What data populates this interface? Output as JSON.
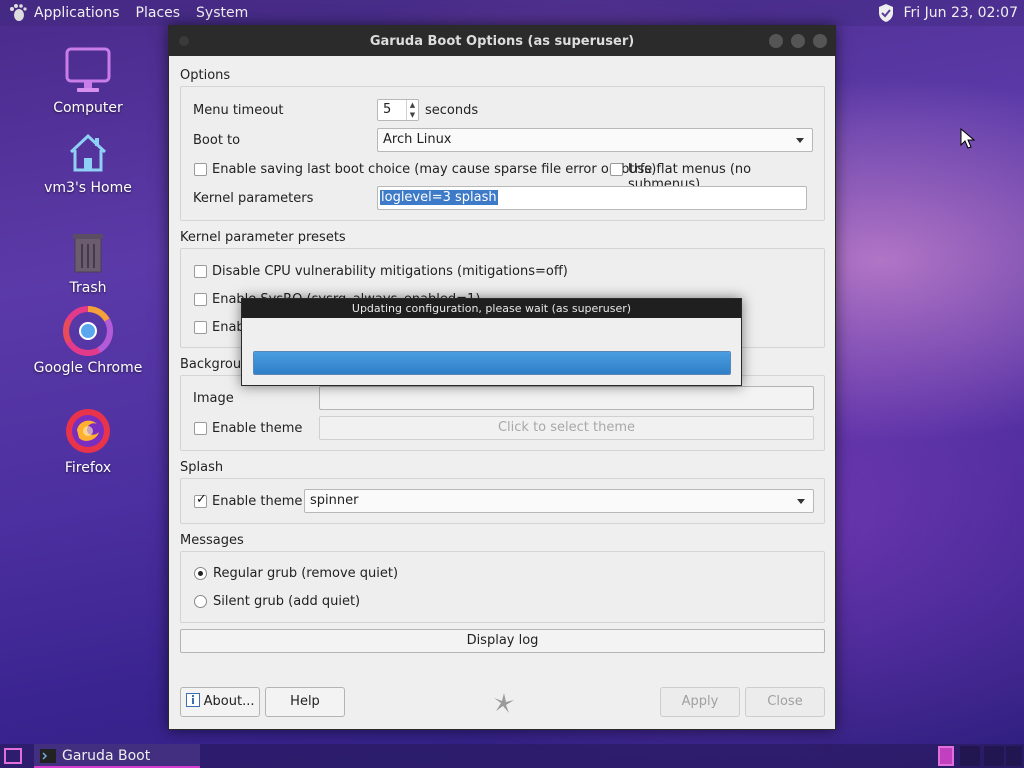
{
  "top_panel": {
    "menus": [
      "Applications",
      "Places",
      "System"
    ],
    "clock": "Fri Jun 23, 02:07"
  },
  "desktop_icons": [
    {
      "label": "Computer",
      "icon": "monitor-icon"
    },
    {
      "label": "vm3's Home",
      "icon": "home-icon"
    },
    {
      "label": "Trash",
      "icon": "trash-icon"
    },
    {
      "label": "Google Chrome",
      "icon": "chrome-icon"
    },
    {
      "label": "Firefox",
      "icon": "firefox-icon"
    }
  ],
  "window": {
    "title": "Garuda Boot Options (as superuser)",
    "options": {
      "label": "Options",
      "menu_timeout_label": "Menu timeout",
      "menu_timeout_value": "5",
      "seconds_label": "seconds",
      "boot_to_label": "Boot to",
      "boot_to_value": "Arch Linux",
      "save_last_label": "Enable saving last boot choice (may cause sparse file error on btrfs)",
      "save_last_checked": false,
      "flat_menus_label": "Use flat menus (no submenus)",
      "flat_menus_checked": false,
      "kernel_params_label": "Kernel parameters",
      "kernel_params_value": "loglevel=3 splash"
    },
    "presets": {
      "label": "Kernel parameter presets",
      "items": [
        {
          "label": "Disable CPU vulnerability mitigations (mitigations=off)",
          "checked": false
        },
        {
          "label": "Enable SysRQ (sysrq_always_enabled=1)",
          "checked": false
        },
        {
          "label": "Enabl",
          "checked": false
        }
      ]
    },
    "background": {
      "label": "Backgroun",
      "image_label": "Image",
      "image_value": "",
      "enable_theme_label": "Enable theme",
      "enable_theme_checked": false,
      "select_theme_label": "Click to select theme"
    },
    "splash": {
      "label": "Splash",
      "enable_theme_label": "Enable theme",
      "enable_theme_checked": true,
      "theme_value": "spinner"
    },
    "messages": {
      "label": "Messages",
      "regular_label": "Regular grub (remove quiet)",
      "silent_label": "Silent grub (add quiet)",
      "selected": "regular"
    },
    "display_log_label": "Display log",
    "buttons": {
      "about": "About...",
      "help": "Help",
      "apply": "Apply",
      "close": "Close"
    }
  },
  "dialog": {
    "title": "Updating configuration, please wait (as superuser)",
    "progress": 1.0,
    "progress_color": "#3a8ad6"
  },
  "taskbar": {
    "task_label": "Garuda Boot Option..."
  }
}
